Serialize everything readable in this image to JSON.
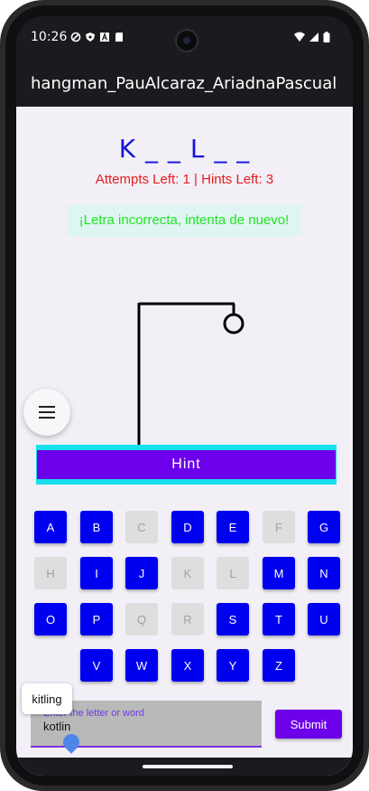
{
  "status_bar": {
    "time": "10:26"
  },
  "app_bar": {
    "title": "hangman_PauAlcaraz_AriadnaPascual"
  },
  "game": {
    "word_display": "K _ _ L _ _",
    "attempts_text": "Attempts Left: 1 | Hints Left: 3",
    "message": "¡Letra incorrecta, intenta de nuevo!"
  },
  "hint_button": {
    "label": "Hint"
  },
  "menu_fab": {
    "icon": "menu-icon"
  },
  "keyboard": {
    "keys": [
      {
        "letter": "A",
        "enabled": true
      },
      {
        "letter": "B",
        "enabled": true
      },
      {
        "letter": "C",
        "enabled": false
      },
      {
        "letter": "D",
        "enabled": true
      },
      {
        "letter": "E",
        "enabled": true
      },
      {
        "letter": "F",
        "enabled": false
      },
      {
        "letter": "G",
        "enabled": true
      },
      {
        "letter": "H",
        "enabled": false
      },
      {
        "letter": "I",
        "enabled": true
      },
      {
        "letter": "J",
        "enabled": true
      },
      {
        "letter": "K",
        "enabled": false
      },
      {
        "letter": "L",
        "enabled": false
      },
      {
        "letter": "M",
        "enabled": true
      },
      {
        "letter": "N",
        "enabled": true
      },
      {
        "letter": "O",
        "enabled": true
      },
      {
        "letter": "P",
        "enabled": true
      },
      {
        "letter": "Q",
        "enabled": false
      },
      {
        "letter": "R",
        "enabled": false
      },
      {
        "letter": "S",
        "enabled": true
      },
      {
        "letter": "T",
        "enabled": true
      },
      {
        "letter": "U",
        "enabled": true
      },
      {
        "letter": "V",
        "enabled": true
      },
      {
        "letter": "W",
        "enabled": true
      },
      {
        "letter": "X",
        "enabled": true
      },
      {
        "letter": "Y",
        "enabled": true
      },
      {
        "letter": "Z",
        "enabled": true
      }
    ]
  },
  "input": {
    "label": "Enter the letter or word",
    "value": "kotlin",
    "suggestion": "kitling"
  },
  "submit_button": {
    "label": "Submit"
  },
  "colors": {
    "primary": "#6c00ea",
    "key_enabled": "#0000f0",
    "key_disabled": "#dedede",
    "word": "#1414d8",
    "attempts": "#e41d1d",
    "message": "#1ee61e"
  }
}
